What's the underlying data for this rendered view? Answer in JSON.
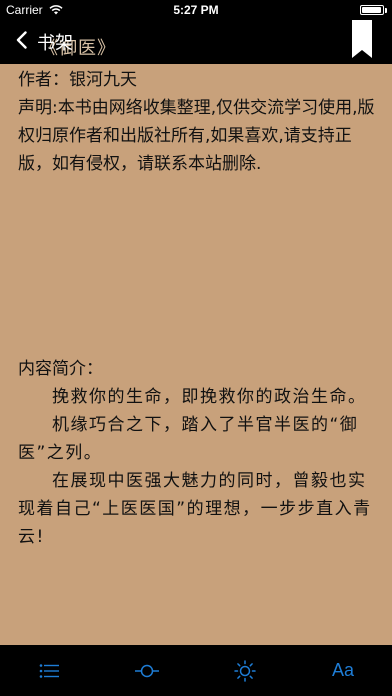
{
  "status_bar": {
    "carrier": "Carrier",
    "time": "5:27 PM"
  },
  "nav": {
    "back_label": "书架",
    "behind_text": "《御医》",
    "bookmark_icon": "bookmark-icon"
  },
  "book": {
    "author_line": "作者：银河九天",
    "disclaimer": "声明:本书由网络收集整理,仅供交流学习使用,版权归原作者和出版社所有,如果喜欢,请支持正版，如有侵权，请联系本站删除.",
    "intro_title": "内容简介：",
    "paragraphs": [
      "挽救你的生命，即挽救你的政治生命。",
      "机缘巧合之下，踏入了半官半医的“御医”之列。",
      "在展现中医强大魅力的同时，曾毅也实现着自己“上医医国”的理想，一步步直入青云!"
    ]
  },
  "toolbar": {
    "items": [
      "list-icon",
      "brightness-slider-icon",
      "sun-icon",
      "font-size-icon"
    ],
    "font_label": "Aa"
  },
  "colors": {
    "page_bg": "#c8a17b",
    "bar_bg": "#000000",
    "accent": "#1e7dd6"
  }
}
